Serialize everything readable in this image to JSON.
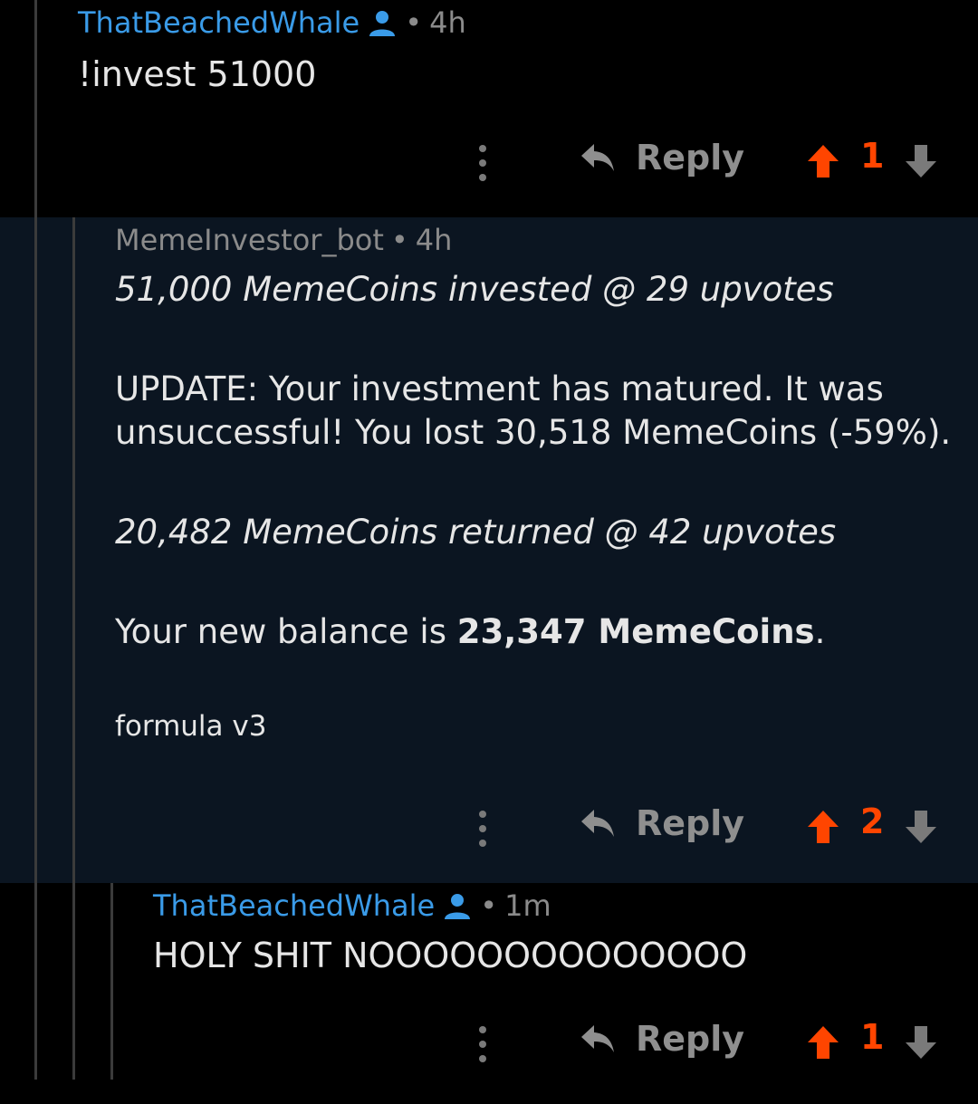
{
  "comments": [
    {
      "username": "ThatBeachedWhale",
      "time": "4h",
      "body": "!invest 51000",
      "reply_label": "Reply",
      "votes": "1"
    },
    {
      "username": "MemeInvestor_bot",
      "time": "4h",
      "line1": "51,000 MemeCoins invested @ 29 upvotes",
      "update": "UPDATE: Your investment has matured. It was unsuccessful! You lost 30,518 MemeCoins (-59%).",
      "line3": "20,482 MemeCoins returned @ 42 upvotes",
      "balance_prefix": "Your new balance is ",
      "balance_value": "23,347 MemeCoins",
      "balance_suffix": ".",
      "footer": "formula v3",
      "reply_label": "Reply",
      "votes": "2"
    },
    {
      "username": "ThatBeachedWhale",
      "time": "1m",
      "body": "HOLY SHIT NOOOOOOOOOOOOOO",
      "reply_label": "Reply",
      "votes": "1"
    }
  ],
  "separator": "•",
  "colors": {
    "username": "#3a9be8",
    "upvote": "#ff4500",
    "muted": "#8f8f8f",
    "bot_bg": "#0b1521"
  }
}
